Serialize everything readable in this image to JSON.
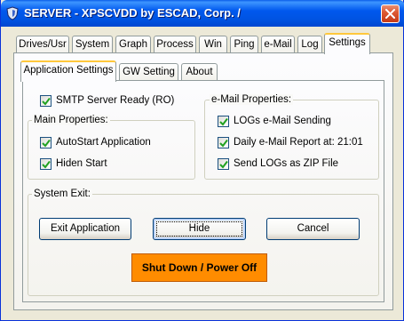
{
  "window": {
    "title": "SERVER - XPSCVDD by ESCAD, Corp.  /"
  },
  "main_tabs": [
    {
      "label": "Drives/Usr"
    },
    {
      "label": "System"
    },
    {
      "label": "Graph"
    },
    {
      "label": "Process"
    },
    {
      "label": "Win"
    },
    {
      "label": "Ping"
    },
    {
      "label": "e-Mail"
    },
    {
      "label": "Log"
    },
    {
      "label": "Settings"
    }
  ],
  "sub_tabs": [
    {
      "label": "Application Settings"
    },
    {
      "label": "GW Setting"
    },
    {
      "label": "About"
    }
  ],
  "smtp_ready": {
    "label": "SMTP Server Ready (RO)",
    "checked": true
  },
  "main_properties": {
    "title": "Main Properties:",
    "items": [
      {
        "label": "AutoStart Application",
        "checked": true
      },
      {
        "label": "Hiden Start",
        "checked": true
      }
    ]
  },
  "email_properties": {
    "title": "e-Mail Properties:",
    "items": [
      {
        "label": "LOGs e-Mail Sending",
        "checked": true
      },
      {
        "label": "Daily e-Mail Report at: 21:01",
        "checked": true
      },
      {
        "label": "Send LOGs as ZIP File",
        "checked": true
      }
    ]
  },
  "system_exit": {
    "title": "System Exit:",
    "exit_label": "Exit Application",
    "hide_label": "Hide",
    "cancel_label": "Cancel",
    "shutdown_label": "Shut Down / Power Off",
    "shutdown_color": "#ff8c00"
  },
  "colors": {
    "titlebar": "#0054e3",
    "active_tab_accent": "#ffc83c",
    "window_bg": "#ece9d8"
  }
}
